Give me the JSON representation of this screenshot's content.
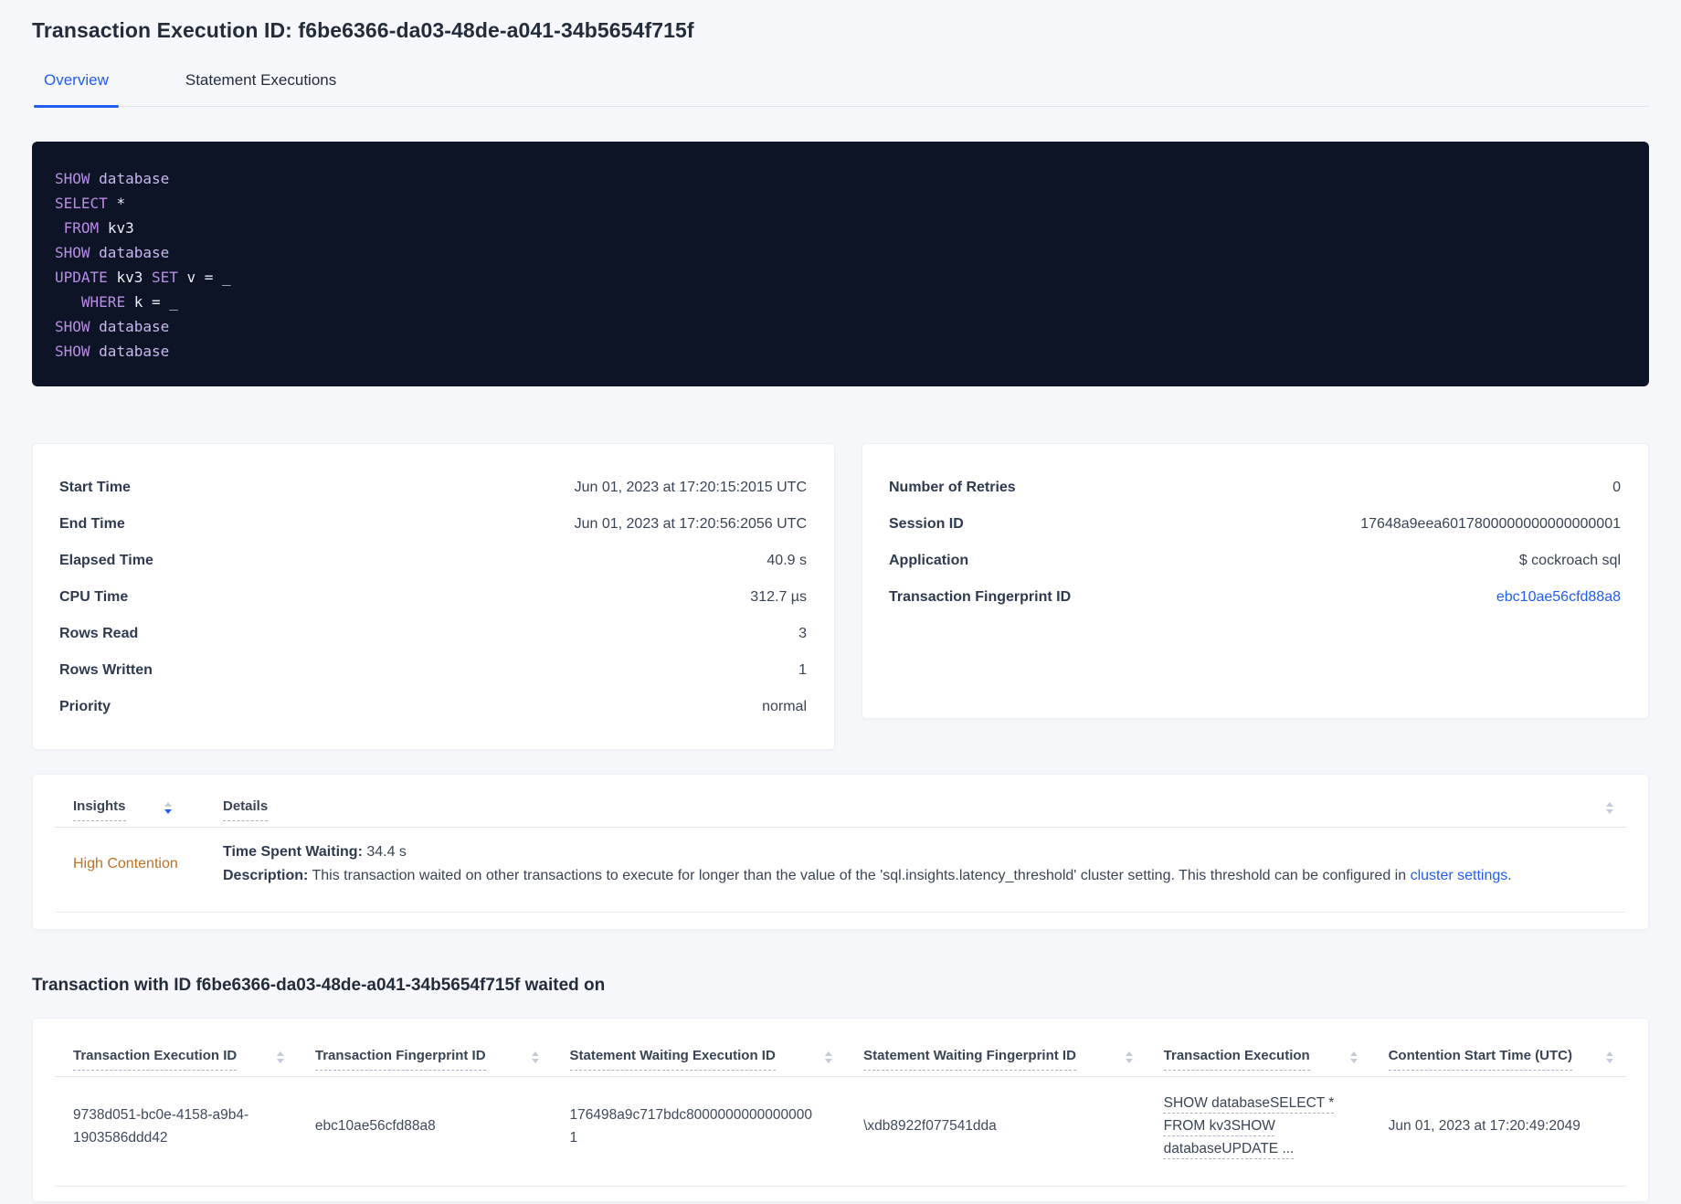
{
  "colors": {
    "accent_blue": "#215DF4",
    "warning_orange": "#C27023",
    "code_bg": "#0D1426",
    "code_keyword": "#BA8CE8",
    "code_secondary": "#C7B8F0",
    "code_plain": "#E9EDF5"
  },
  "header": {
    "title": "Transaction Execution ID: f6be6366-da03-48de-a041-34b5654f715f"
  },
  "tabs": [
    {
      "label": "Overview",
      "active": true
    },
    {
      "label": "Statement Executions",
      "active": false
    }
  ],
  "sql": {
    "lines": [
      [
        {
          "t": "SHOW ",
          "c": "kw"
        },
        {
          "t": "database",
          "c": "sec"
        }
      ],
      [
        {
          "t": "SELECT ",
          "c": "kw"
        },
        {
          "t": "*",
          "c": "pl"
        }
      ],
      [
        {
          "t": " ",
          "c": "pl"
        },
        {
          "t": "FROM ",
          "c": "kw"
        },
        {
          "t": "kv3",
          "c": "pl"
        }
      ],
      [
        {
          "t": "SHOW ",
          "c": "kw"
        },
        {
          "t": "database",
          "c": "sec"
        }
      ],
      [
        {
          "t": "UPDATE ",
          "c": "kw"
        },
        {
          "t": "kv3 ",
          "c": "pl"
        },
        {
          "t": "SET ",
          "c": "kw"
        },
        {
          "t": "v = _",
          "c": "pl"
        }
      ],
      [
        {
          "t": "   ",
          "c": "pl"
        },
        {
          "t": "WHERE ",
          "c": "kw"
        },
        {
          "t": "k = _",
          "c": "pl"
        }
      ],
      [
        {
          "t": "SHOW ",
          "c": "kw"
        },
        {
          "t": "database",
          "c": "sec"
        }
      ],
      [
        {
          "t": "SHOW ",
          "c": "kw"
        },
        {
          "t": "database",
          "c": "sec"
        }
      ]
    ]
  },
  "summary_left": {
    "rows": [
      {
        "label": "Start Time",
        "value": "Jun 01, 2023 at 17:20:15:2015 UTC"
      },
      {
        "label": "End Time",
        "value": "Jun 01, 2023 at 17:20:56:2056 UTC"
      },
      {
        "label": "Elapsed Time",
        "value": "40.9 s"
      },
      {
        "label": "CPU Time",
        "value": "312.7 µs"
      },
      {
        "label": "Rows Read",
        "value": "3"
      },
      {
        "label": "Rows Written",
        "value": "1"
      },
      {
        "label": "Priority",
        "value": "normal"
      }
    ]
  },
  "summary_right": {
    "rows": [
      {
        "label": "Number of Retries",
        "value": "0"
      },
      {
        "label": "Session ID",
        "value": "17648a9eea6017800000000000000001"
      },
      {
        "label": "Application",
        "value": "$ cockroach sql"
      },
      {
        "label": "Transaction Fingerprint ID",
        "value": "ebc10ae56cfd88a8",
        "link": true
      }
    ]
  },
  "insights_table": {
    "headers": [
      {
        "label": "Insights",
        "sort": "desc"
      },
      {
        "label": "Details",
        "sort": null
      }
    ],
    "row": {
      "insight": "High Contention",
      "waiting_label": "Time Spent Waiting:",
      "waiting_value": " 34.4 s",
      "description_label": "Description:",
      "description_text": " This transaction waited on other transactions to execute for longer than the value of the 'sql.insights.latency_threshold' cluster setting. This threshold can be configured in ",
      "description_link": "cluster settings",
      "description_suffix": "."
    }
  },
  "waited_section": {
    "heading": "Transaction with ID f6be6366-da03-48de-a041-34b5654f715f waited on",
    "columns": [
      "Transaction Execution ID",
      "Transaction Fingerprint ID",
      "Statement Waiting Execution ID",
      "Statement Waiting Fingerprint ID",
      "Transaction Execution",
      "Contention Start Time (UTC)"
    ],
    "row_cells": [
      {
        "text": "9738d051-bc0e-4158-a9b4-1903586ddd42"
      },
      {
        "text": "ebc10ae56cfd88a8"
      },
      {
        "text": "176498a9c717bdc80000000000000001"
      },
      {
        "text": "\\xdb8922f077541dda"
      },
      {
        "text": "SHOW databaseSELECT * FROM kv3SHOW databaseUPDATE ...",
        "style": "dashed-link"
      },
      {
        "text": "Jun 01, 2023 at 17:20:49:2049"
      }
    ]
  }
}
